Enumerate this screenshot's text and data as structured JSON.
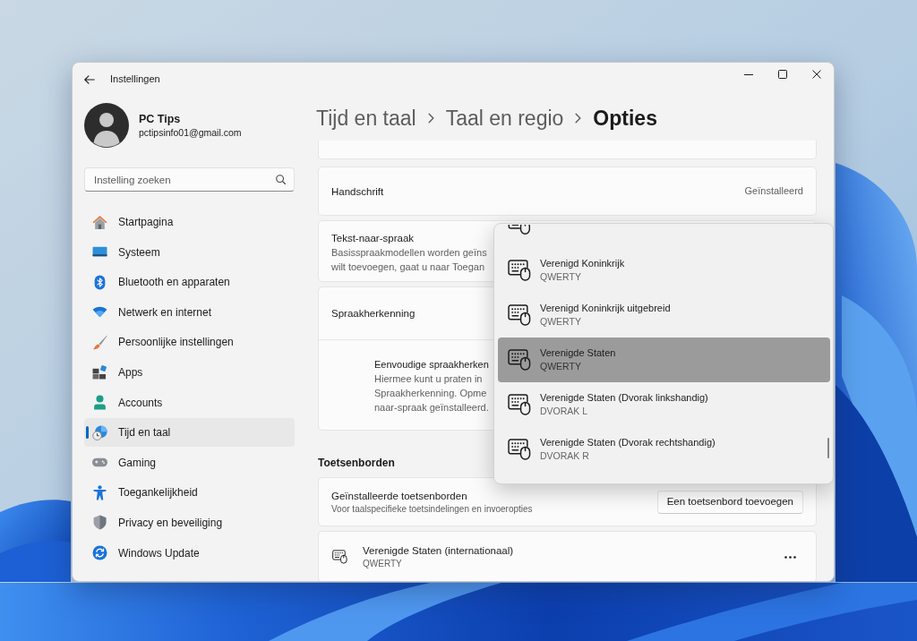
{
  "window": {
    "title": "Instellingen"
  },
  "profile": {
    "name": "PC Tips",
    "email": "pctipsinfo01@gmail.com"
  },
  "search": {
    "placeholder": "Instelling zoeken"
  },
  "sidebar": {
    "items": [
      {
        "label": "Startpagina",
        "selected": false
      },
      {
        "label": "Systeem",
        "selected": false
      },
      {
        "label": "Bluetooth en apparaten",
        "selected": false
      },
      {
        "label": "Netwerk en internet",
        "selected": false
      },
      {
        "label": "Persoonlijke instellingen",
        "selected": false
      },
      {
        "label": "Apps",
        "selected": false
      },
      {
        "label": "Accounts",
        "selected": false
      },
      {
        "label": "Tijd en taal",
        "selected": true
      },
      {
        "label": "Gaming",
        "selected": false
      },
      {
        "label": "Toegankelijkheid",
        "selected": false
      },
      {
        "label": "Privacy en beveiliging",
        "selected": false
      },
      {
        "label": "Windows Update",
        "selected": false
      }
    ]
  },
  "breadcrumb": [
    {
      "label": "Tijd en taal",
      "current": false
    },
    {
      "label": "Taal en regio",
      "current": false
    },
    {
      "label": "Opties",
      "current": true
    }
  ],
  "settings": [
    {
      "kind": "status",
      "title": "Handschrift",
      "status": "Geïnstalleerd"
    },
    {
      "kind": "info",
      "title": "Tekst-naar-spraak",
      "description": [
        "Basisspraakmodellen worden geïns",
        "wilt toevoegen, gaat u naar Toegan"
      ]
    },
    {
      "kind": "group",
      "title": "Spraakherkenning",
      "option": {
        "title": "Eenvoudige spraakherken",
        "description": [
          "Hiermee kunt u praten in",
          "Spraakherkenning. Opme",
          "naar-spraak geïnstalleerd."
        ]
      }
    }
  ],
  "keyboards": {
    "heading": "Toetsenborden",
    "installed": {
      "title": "Geïnstalleerde toetsenborden",
      "description": "Voor taalspecifieke toetsindelingen en invoeropties",
      "button": "Een toetsenbord toevoegen"
    },
    "items": [
      {
        "name": "Verenigde Staten (internationaal)",
        "layout": "QWERTY"
      }
    ]
  },
  "dropdown": {
    "items": [
      {
        "title": "Verenigd Koninkrijk",
        "layout": "QWERTY",
        "selected": false
      },
      {
        "title": "Verenigd Koninkrijk uitgebreid",
        "layout": "QWERTY",
        "selected": false
      },
      {
        "title": "Verenigde Staten",
        "layout": "QWERTY",
        "selected": true
      },
      {
        "title": "Verenigde Staten (Dvorak linkshandig)",
        "layout": "DVORAK L",
        "selected": false
      },
      {
        "title": "Verenigde Staten (Dvorak rechtshandig)",
        "layout": "DVORAK R",
        "selected": false
      }
    ]
  }
}
